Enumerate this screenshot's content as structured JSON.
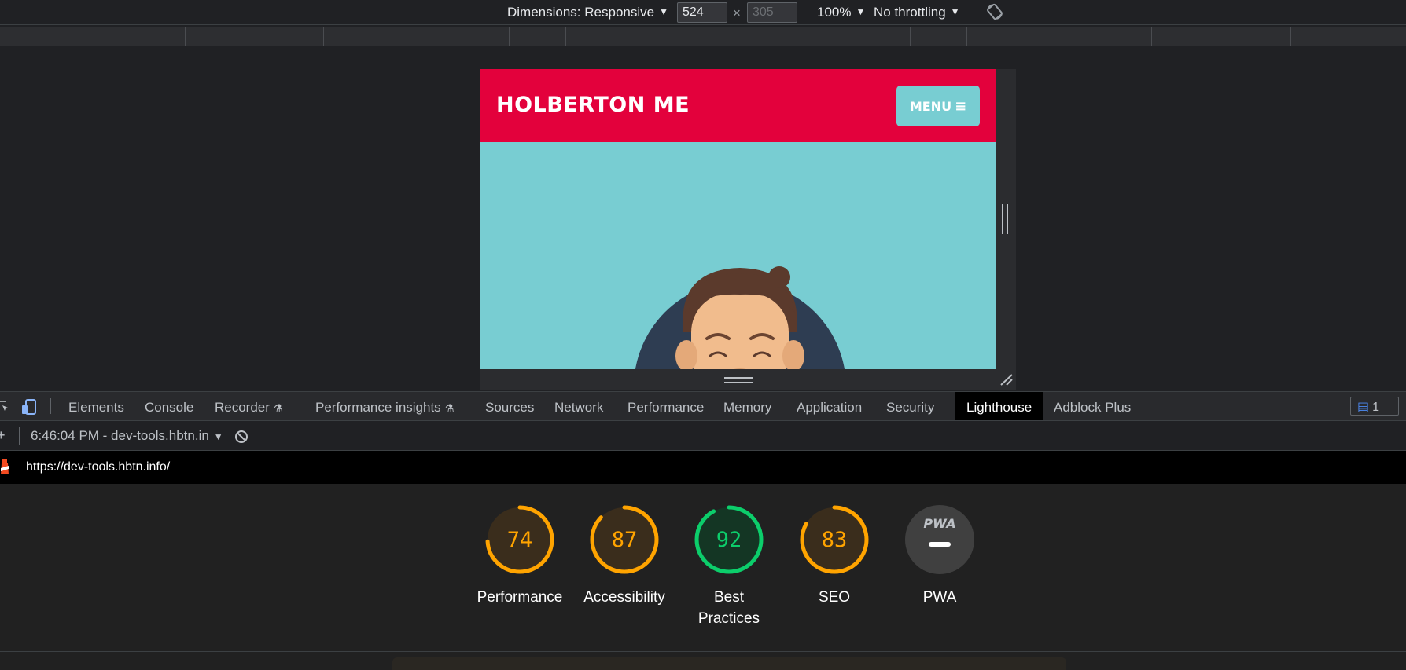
{
  "device_toolbar": {
    "dimensions_label": "Dimensions: Responsive",
    "width": "524",
    "height": "305",
    "zoom": "100%",
    "throttling": "No throttling"
  },
  "site": {
    "title": "HOLBERTON ME",
    "menu_label": "MENU"
  },
  "tabs": [
    {
      "label": "Elements"
    },
    {
      "label": "Console"
    },
    {
      "label": "Recorder"
    },
    {
      "label": "Performance insights"
    },
    {
      "label": "Sources"
    },
    {
      "label": "Network"
    },
    {
      "label": "Performance"
    },
    {
      "label": "Memory"
    },
    {
      "label": "Application"
    },
    {
      "label": "Security"
    },
    {
      "label": "Lighthouse"
    },
    {
      "label": "Adblock Plus"
    }
  ],
  "issues_count": "1",
  "lighthouse": {
    "report_select": "6:46:04 PM - dev-tools.hbtn.in",
    "url": "https://dev-tools.hbtn.info/",
    "pwa_badge_text": "PWA",
    "scores": [
      {
        "label": "Performance",
        "value": "74",
        "fraction": 0.74,
        "color": "#ffa400"
      },
      {
        "label": "Accessibility",
        "value": "87",
        "fraction": 0.87,
        "color": "#ffa400"
      },
      {
        "label": "Best",
        "label2": "Practices",
        "value": "92",
        "fraction": 0.92,
        "color": "#0cce6b"
      },
      {
        "label": "SEO",
        "value": "83",
        "fraction": 0.83,
        "color": "#ffa400"
      },
      {
        "label": "PWA",
        "value": "",
        "color": "#9aa0a6"
      }
    ]
  },
  "colors": {
    "site_header": "#e3013c",
    "site_body": "#78cdd2",
    "lighthouse_tab_active": "#000000"
  }
}
